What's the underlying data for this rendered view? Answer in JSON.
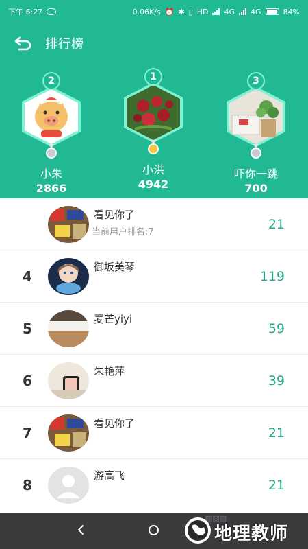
{
  "status_bar": {
    "time": "下午 6:27",
    "net_speed": "0.06K/s",
    "hd": "HD",
    "net1": "4G",
    "net2": "4G",
    "battery": "84%"
  },
  "header": {
    "title": "排行榜"
  },
  "podium": [
    {
      "rank": "2",
      "name": "小朱",
      "score": "2866",
      "medal": "silver"
    },
    {
      "rank": "1",
      "name": "小洪",
      "score": "4942",
      "medal": "gold"
    },
    {
      "rank": "3",
      "name": "吓你一跳",
      "score": "700",
      "medal": "silver"
    }
  ],
  "list": [
    {
      "rank": "",
      "name": "看见你了",
      "sub": "当前用户排名:7",
      "score": "21"
    },
    {
      "rank": "4",
      "name": "御坂美琴",
      "sub": "",
      "score": "119"
    },
    {
      "rank": "5",
      "name": "麦芒yiyi",
      "sub": "",
      "score": "59"
    },
    {
      "rank": "6",
      "name": "朱艳萍",
      "sub": "",
      "score": "39"
    },
    {
      "rank": "7",
      "name": "看见你了",
      "sub": "",
      "score": "21"
    },
    {
      "rank": "8",
      "name": "游高飞",
      "sub": "",
      "score": "21"
    }
  ],
  "watermark": {
    "text": "地理教师"
  },
  "colors": {
    "accent": "#21b894",
    "score": "#21a98a",
    "navbar": "#3a3b3d",
    "gold": "#f4c542",
    "silver": "#c9cbd0"
  }
}
